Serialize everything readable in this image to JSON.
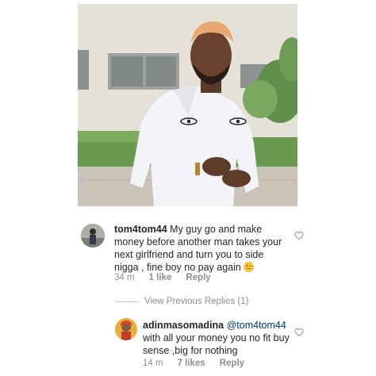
{
  "comment1": {
    "username": "tom4tom44",
    "text": " My guy go and make money before another man takes your next girlfriend and turn you to side nigga , fine boy no pay again ",
    "emoji": "slightly-smiling-face-icon",
    "time": "34 m",
    "likes": "1 like",
    "reply_label": "Reply"
  },
  "view_replies": "View Previous Replies (1)",
  "reply1": {
    "username": "adinmasomadina",
    "mention": "@tom4tom44",
    "text": "with all your money you no fit buy sense ,big for nothing",
    "time": "14 m",
    "likes": "7 likes",
    "reply_label": "Reply"
  },
  "colors": {
    "username": "#262626",
    "mention": "#00376b",
    "meta": "#8e8e8e",
    "heart": "#8e8e8e"
  }
}
